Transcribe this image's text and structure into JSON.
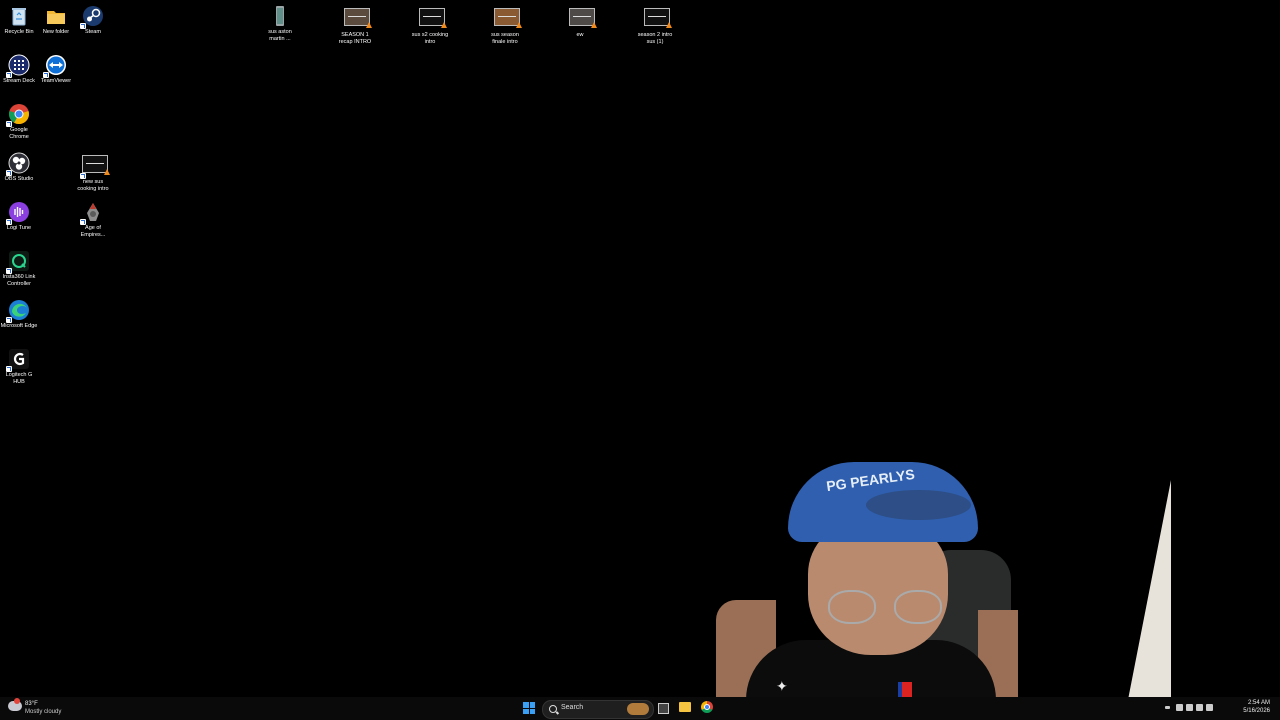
{
  "desktop": {
    "left_column": [
      {
        "label": "Recycle Bin",
        "icon": "recycle-bin-icon"
      },
      {
        "label": "Stream Deck",
        "icon": "stream-deck-icon"
      },
      {
        "label": "Google Chrome",
        "icon": "chrome-icon"
      },
      {
        "label": "OBS Studio",
        "icon": "obs-icon"
      },
      {
        "label": "Logi Tune",
        "icon": "logi-tune-icon"
      },
      {
        "label": "Insta360 Link Controller",
        "icon": "insta360-icon"
      },
      {
        "label": "Microsoft Edge",
        "icon": "edge-icon"
      },
      {
        "label": "Logitech G HUB",
        "icon": "ghub-icon"
      }
    ],
    "second_column": [
      {
        "label": "New folder",
        "icon": "folder-icon"
      },
      {
        "label": "TeamViewer",
        "icon": "teamviewer-icon"
      }
    ],
    "third_column": [
      {
        "label": "Steam",
        "icon": "steam-icon"
      },
      {
        "label": "new sus cooking intro",
        "icon": "video-file-icon"
      },
      {
        "label": "Age of Empires...",
        "icon": "age-of-empires-icon"
      }
    ],
    "top_row": [
      {
        "label": "sus aston martin ...",
        "icon": "file-icon"
      },
      {
        "label": "SEASON 1 recap INTRO",
        "icon": "video-file-icon"
      },
      {
        "label": "sus s2 cooking intro",
        "icon": "video-file-icon"
      },
      {
        "label": "sus season finale intro",
        "icon": "video-file-icon"
      },
      {
        "label": "ew",
        "icon": "video-file-icon"
      },
      {
        "label": "season 2 intro sus (1)",
        "icon": "video-file-icon"
      }
    ]
  },
  "webcam": {
    "cap_text": "PG PEARLYS"
  },
  "taskbar": {
    "weather_temp": "83°F",
    "weather_desc": "Mostly cloudy",
    "search_label": "Search",
    "clock_time": "2:54 AM",
    "clock_date": "5/16/2026"
  }
}
